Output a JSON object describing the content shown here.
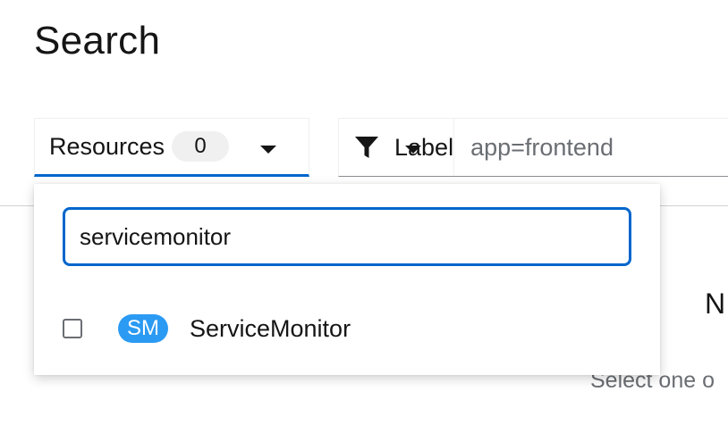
{
  "page": {
    "title": "Search"
  },
  "resources": {
    "label": "Resources",
    "count": "0"
  },
  "filter": {
    "type_label": "Label",
    "input_value": "app=frontend"
  },
  "menu": {
    "search_value": "servicemonitor",
    "items": [
      {
        "badge": "SM",
        "label": "ServiceMonitor",
        "checked": false
      }
    ]
  },
  "empty_state": {
    "title": "N",
    "description": "Select one o"
  },
  "colors": {
    "accent": "#0066cc",
    "badge_blue": "#2b9af3",
    "muted_text": "#6a6e73"
  },
  "icons": {
    "filter": "filter-icon",
    "caret": "caret-down-icon"
  }
}
